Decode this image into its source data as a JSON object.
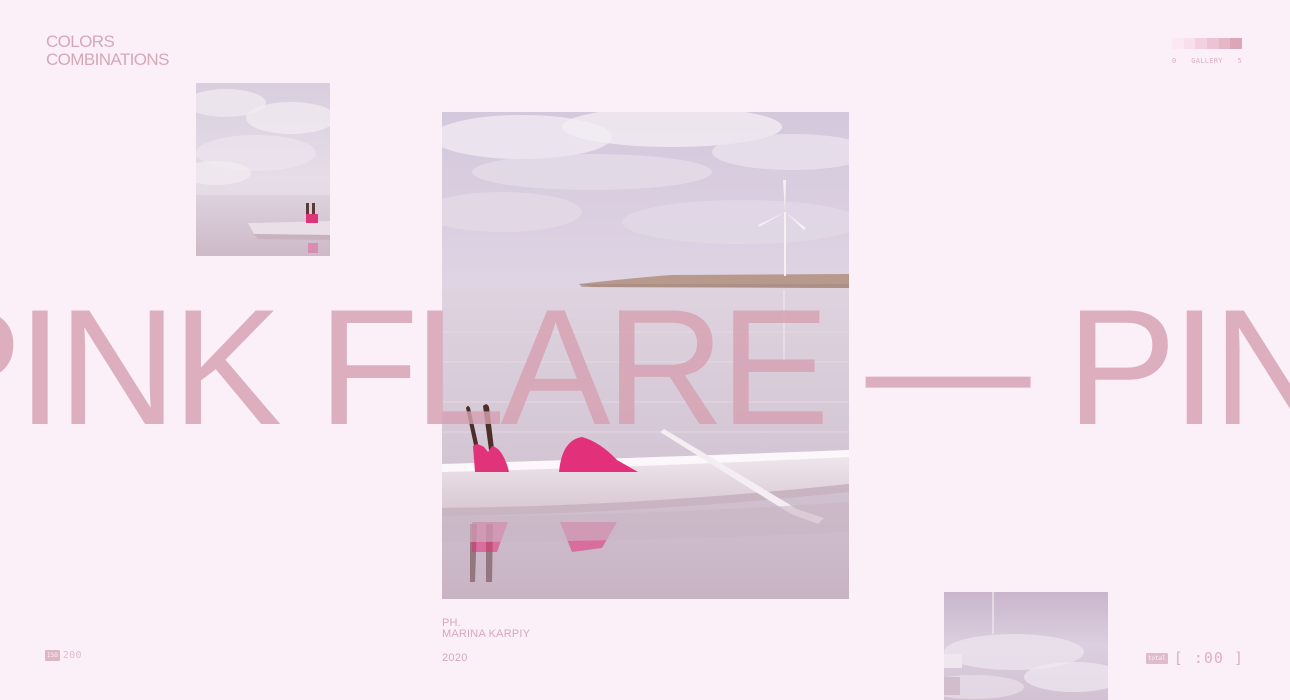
{
  "brand": {
    "line1": "COLORS",
    "line2": "COMBINATIONS"
  },
  "gallery_nav": {
    "left_index": "0",
    "label": "GALLERY",
    "right_index": "5",
    "palette": [
      "#fbe8f2",
      "#f8dfeb",
      "#f2d0dd",
      "#ecc3d2",
      "#e5b6c6",
      "#dba6b8"
    ]
  },
  "headline": {
    "text": "PINK FLARE — PINK FLARE — PINK FLARE"
  },
  "photos": {
    "small": {
      "icon": "woman-in-boat-photo"
    },
    "main": {
      "icon": "woman-in-boat-photo"
    },
    "bottom": {
      "icon": "lake-reflection-photo"
    }
  },
  "credit": {
    "prefix": "PH.",
    "photographer": "MARINA KARPIY",
    "year": "2020"
  },
  "iso": {
    "label": "ISO",
    "value": "200"
  },
  "total": {
    "label": "total",
    "value": "[ :00 ]"
  },
  "colors": {
    "background": "#fcf0f8",
    "text": "#d5a8b6",
    "headline": "#d5a0b1",
    "accent_magenta": "#e0337a"
  }
}
